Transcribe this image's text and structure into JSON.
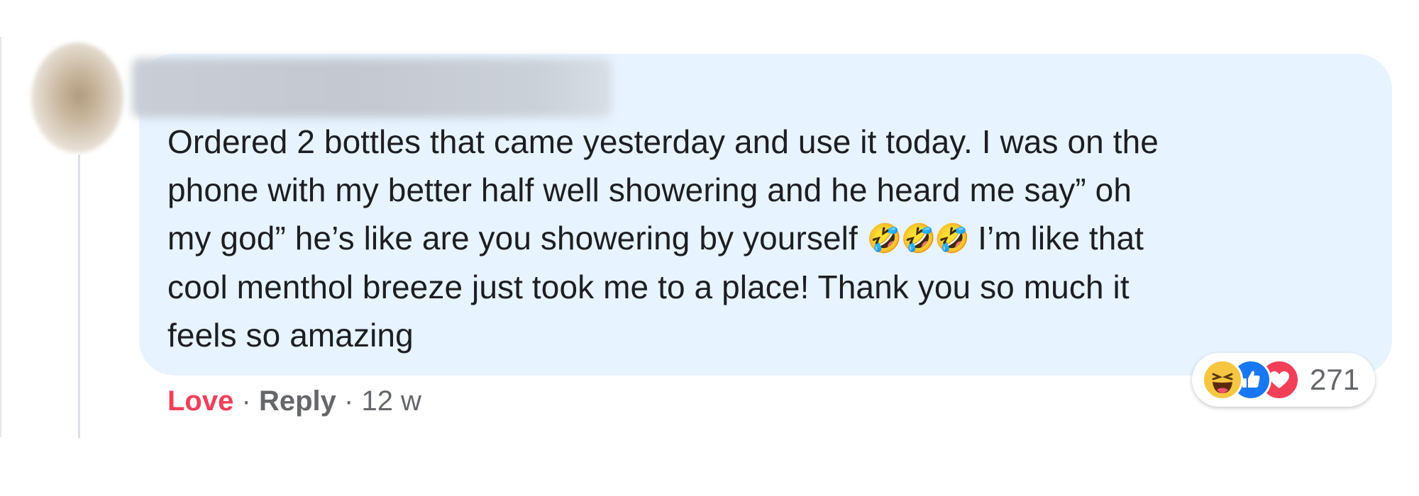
{
  "comment": {
    "author_name": "",
    "text_lines": [
      "Ordered 2 bottles that came yesterday and use it today. I was on the",
      "phone with my better half well showering and he heard me say” oh",
      "my god” he’s like are you showering by yourself",
      "cool menthol breeze just took me to a place! Thank you so much it",
      "feels so amazing"
    ],
    "inline_emoji": "🤣🤣🤣",
    "line3_tail": " I’m like that"
  },
  "actions": {
    "love_label": "Love",
    "separator": "·",
    "reply_label": "Reply",
    "timestamp": "12 w"
  },
  "reactions": {
    "icons": [
      "haha-icon",
      "like-icon",
      "love-icon"
    ],
    "count": "271"
  },
  "colors": {
    "bubble": "#e7f3ff",
    "love": "#f33e58",
    "secondary_text": "#65676b",
    "like_blue": "#1877f2"
  }
}
